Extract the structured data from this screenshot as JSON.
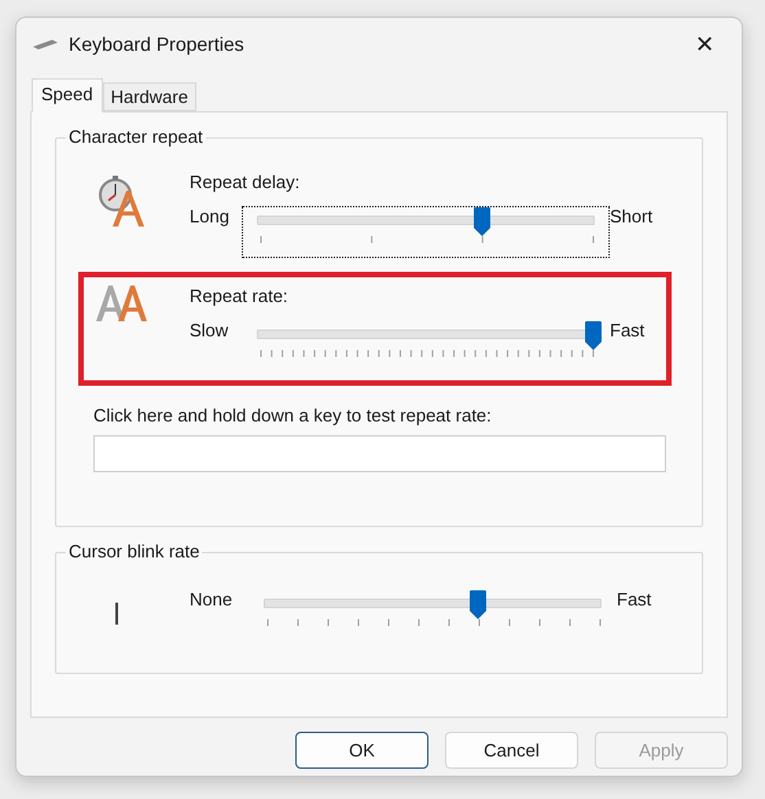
{
  "window": {
    "title": "Keyboard Properties",
    "close": "✕"
  },
  "tabs": [
    {
      "label": "Speed",
      "selected": true
    },
    {
      "label": "Hardware",
      "selected": false
    }
  ],
  "character_repeat": {
    "title": "Character repeat",
    "sliders": [
      {
        "kind": "delay",
        "label": "Repeat delay:",
        "min_label": "Long",
        "max_label": "Short",
        "level": 0.667,
        "focused": true,
        "highlighted": false
      },
      {
        "kind": "rate",
        "label": "Repeat rate:",
        "min_label": "Slow",
        "max_label": "Fast",
        "level": 1.0,
        "focused": false,
        "highlighted": true
      }
    ],
    "test": {
      "label": "Click here and hold down a key to test repeat rate:"
    }
  },
  "cursor_blink": {
    "title": "Cursor blink rate",
    "min_label": "None",
    "max_label": "Fast",
    "level": 0.636
  },
  "buttons": [
    {
      "label": "OK",
      "default": true,
      "disabled": false
    },
    {
      "label": "Cancel",
      "default": false,
      "disabled": false
    },
    {
      "label": "Apply",
      "default": false,
      "disabled": true
    }
  ]
}
